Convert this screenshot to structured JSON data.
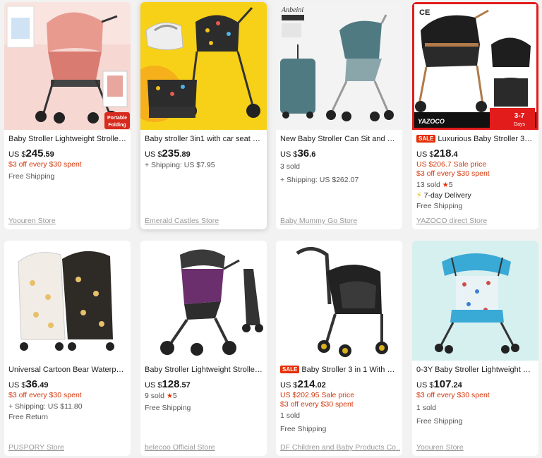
{
  "products": [
    {
      "title": "Baby Stroller Lightweight Stroller T...",
      "price_cur": "US $",
      "price_int": "245",
      "price_dec": ".59",
      "promo": "$3 off every $30 spent",
      "shipping": "Free Shipping",
      "store": "Yoouren Store",
      "badge": "Portable Folding"
    },
    {
      "title": "Baby stroller 3in1 with car seat Hig...",
      "price_cur": "US $",
      "price_int": "235",
      "price_dec": ".89",
      "shipping": "+ Shipping: US $7.95",
      "store": "Emerald Castles Store"
    },
    {
      "title": "New Baby Stroller Can Sit and Lie L...",
      "price_cur": "US $",
      "price_int": "36",
      "price_dec": ".6",
      "sold": "3 sold",
      "shipping": "+ Shipping: US $262.07",
      "store": "Baby Mummy Go Store",
      "brand": "Anbeini"
    },
    {
      "sale_tag": "SALE",
      "title": "Luxurious Baby Stroller 3 in...",
      "price_cur": "US $",
      "price_int": "218",
      "price_dec": ".4",
      "sale_price": "US $206.7 Sale price",
      "promo": "$3 off every $30 spent",
      "sold": "13 sold",
      "rating": "5",
      "delivery": "7-day Delivery",
      "shipping": "Free Shipping",
      "store": "YAZOCO direct Store",
      "ce": "CE",
      "img_brand": "YAZOCO",
      "days": "3-7 Days"
    },
    {
      "title": "Universal Cartoon Bear Waterproo...",
      "price_cur": "US $",
      "price_int": "36",
      "price_dec": ".49",
      "promo": "$3 off every $30 spent",
      "shipping": "+ Shipping: US $11.80",
      "returns": "Free Return",
      "store": "PUSPORY Store"
    },
    {
      "title": "Baby Stroller Lightweight Stroller ...",
      "price_cur": "US $",
      "price_int": "128",
      "price_dec": ".57",
      "sold": "9 sold",
      "rating": "5",
      "shipping": "Free Shipping",
      "store": "belecoo Official Store"
    },
    {
      "sale_tag": "SALE",
      "title": "Baby Stroller 3 in 1 With Car ...",
      "price_cur": "US $",
      "price_int": "214",
      "price_dec": ".02",
      "sale_price": "US $202.95 Sale price",
      "promo": "$3 off every $30 spent",
      "sold": "1 sold",
      "shipping": "Free Shipping",
      "store": "DF Children and Baby Products Co..."
    },
    {
      "title": "0-3Y Baby Stroller Lightweight Fold...",
      "price_cur": "US $",
      "price_int": "107",
      "price_dec": ".24",
      "promo": "$3 off every $30 spent",
      "sold": "1 sold",
      "shipping": "Free Shipping",
      "store": "Yoouren Store"
    }
  ],
  "colors": {
    "accent_red": "#d4380d",
    "sale_red": "#e62e04",
    "background": "#f2f2f2",
    "store_grey": "#999999"
  }
}
